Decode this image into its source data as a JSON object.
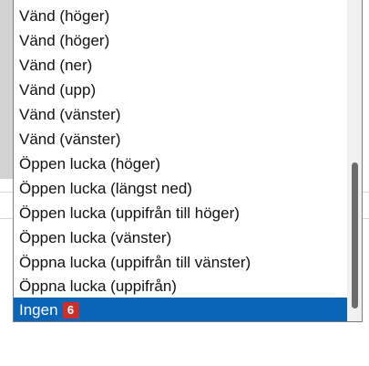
{
  "dropdown": {
    "options": [
      {
        "label": "Vänd (höger)"
      },
      {
        "label": "Vänd (höger)"
      },
      {
        "label": "Vänd (ner)"
      },
      {
        "label": "Vänd (upp)"
      },
      {
        "label": "Vänd (vänster)"
      },
      {
        "label": "Vänd (vänster)"
      },
      {
        "label": "Öppen lucka (höger)"
      },
      {
        "label": "Öppen lucka (längst ned)"
      },
      {
        "label": "Öppen lucka (uppifrån till höger)"
      },
      {
        "label": "Öppen lucka (vänster)"
      },
      {
        "label": "Öppna lucka (uppifrån till vänster)"
      },
      {
        "label": "Öppna lucka (uppifrån)"
      },
      {
        "label": "Ingen",
        "badge": "6",
        "selected": true
      }
    ],
    "selected_index": 12
  },
  "colors": {
    "selection_bg": "#0a64b8",
    "badge_bg": "#c9302c",
    "scroll_thumb": "#6b6b6b"
  }
}
